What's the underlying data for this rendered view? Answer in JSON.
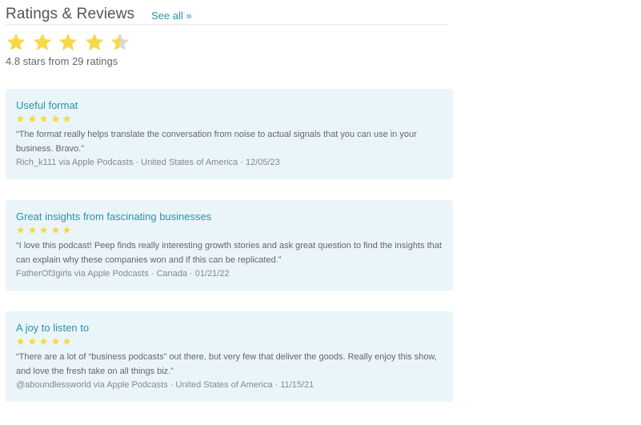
{
  "section": {
    "title": "Ratings & Reviews",
    "see_all_label": "See all »"
  },
  "rating": {
    "value": 4.8,
    "stars_filled": 4.5,
    "stars_total": 5,
    "summary": "4.8 stars from 29 ratings"
  },
  "colors": {
    "star": "#f7d84a",
    "star_empty": "#d9d9d9",
    "accent": "#2a93a7",
    "card_bg": "#eaf5fa"
  },
  "reviews": [
    {
      "title": "Useful format",
      "stars": 5,
      "text": "“The format really helps translate the conversation from noise to actual signals that you can use in your business. Bravo.”",
      "meta": "Rich_k111 via Apple Podcasts · United States of America · 12/05/23"
    },
    {
      "title": "Great insights from fascinating businesses",
      "stars": 5,
      "text": "“I love this podcast! Peep finds really interesting growth stories and ask great question to find the insights that can explain why these companies won and if this can be replicated.”",
      "meta": "FatherOf3girls via Apple Podcasts · Canada · 01/21/22"
    },
    {
      "title": "A joy to listen to",
      "stars": 5,
      "text": "“There are a lot of “business podcasts” out there, but very few that deliver the goods. Really enjoy this show, and love the fresh take on all things biz.”",
      "meta": "@aboundlessworld via Apple Podcasts · United States of America · 11/15/21"
    }
  ]
}
